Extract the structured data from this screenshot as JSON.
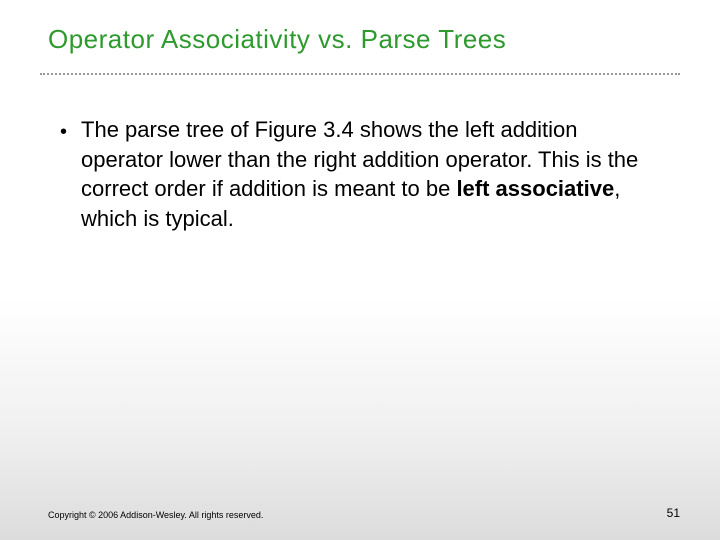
{
  "title": "Operator Associativity vs. Parse Trees",
  "bullet": {
    "text_before_bold": "The parse tree of Figure 3.4 shows the left addition operator lower than the right addition operator. This is the correct order if addition is meant to be ",
    "bold_text": "left associative",
    "text_after_bold": ", which is typical."
  },
  "footer": {
    "copyright": "Copyright © 2006 Addison-Wesley. All rights reserved.",
    "page_number": "51"
  }
}
